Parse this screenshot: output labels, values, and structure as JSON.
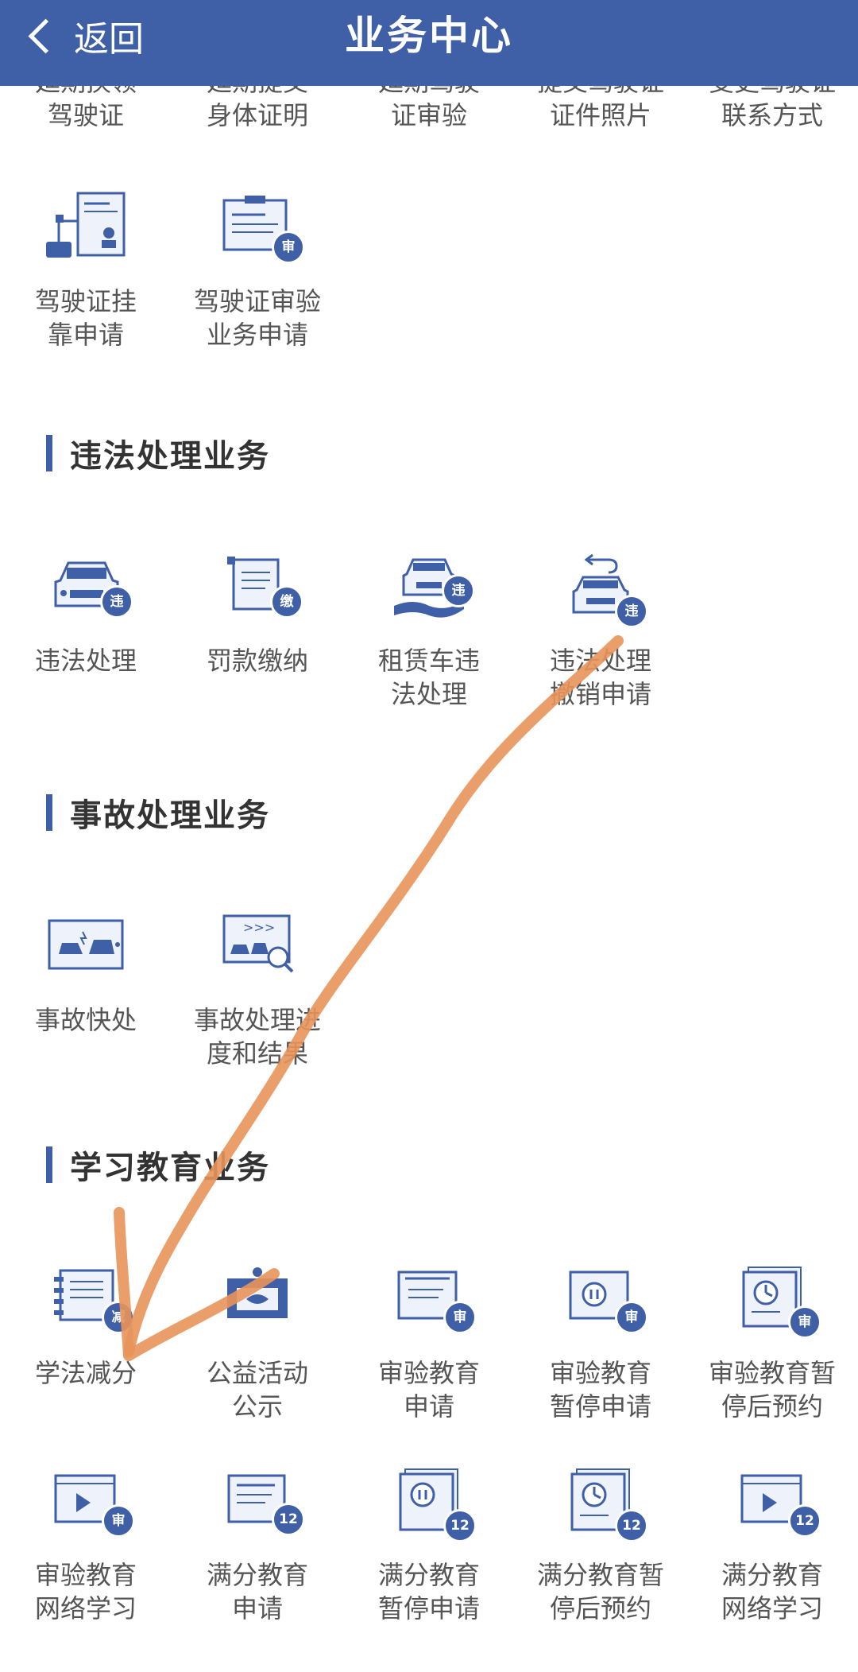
{
  "header": {
    "back_label": "返回",
    "title": "业务中心"
  },
  "top_row_partial": [
    "延期换领\n驾驶证",
    "延期提交\n身体证明",
    "延期驾驶\n证审验",
    "提交驾驶证\n证件照片",
    "变更驾驶证\n联系方式"
  ],
  "license_row2": [
    {
      "label": "驾驶证挂\n靠申请",
      "icon": "license-affiliation-icon"
    },
    {
      "label": "驾驶证审验\n业务申请",
      "icon": "license-review-icon",
      "badge": "审"
    }
  ],
  "sections": {
    "violation": {
      "title": "违法处理业务",
      "items": [
        {
          "label": "违法处理",
          "icon": "car-violation-icon",
          "badge": "违"
        },
        {
          "label": "罚款缴纳",
          "icon": "fine-payment-icon",
          "badge": "缴"
        },
        {
          "label": "租赁车违\n法处理",
          "icon": "rental-car-violation-icon",
          "badge": "违"
        },
        {
          "label": "违法处理\n撤销申请",
          "icon": "violation-revoke-icon",
          "badge": "违"
        }
      ]
    },
    "accident": {
      "title": "事故处理业务",
      "items": [
        {
          "label": "事故快处",
          "icon": "accident-quick-icon"
        },
        {
          "label": "事故处理进\n度和结果",
          "icon": "accident-progress-icon"
        }
      ]
    },
    "education": {
      "title": "学习教育业务",
      "row1": [
        {
          "label": "学法减分",
          "icon": "study-deduct-icon",
          "badge": "减"
        },
        {
          "label": "公益活动\n公示",
          "icon": "charity-activity-icon"
        },
        {
          "label": "审验教育\n申请",
          "icon": "review-edu-apply-icon",
          "badge": "审"
        },
        {
          "label": "审验教育\n暂停申请",
          "icon": "review-edu-pause-icon",
          "badge": "审"
        },
        {
          "label": "审验教育暂\n停后预约",
          "icon": "review-edu-appointment-icon",
          "badge": "审"
        }
      ],
      "row2": [
        {
          "label": "审验教育\n网络学习",
          "icon": "review-edu-online-icon",
          "badge": "审"
        },
        {
          "label": "满分教育\n申请",
          "icon": "full-score-apply-icon",
          "badge": "12"
        },
        {
          "label": "满分教育\n暂停申请",
          "icon": "full-score-pause-icon",
          "badge": "12"
        },
        {
          "label": "满分教育暂\n停后预约",
          "icon": "full-score-appointment-icon",
          "badge": "12"
        },
        {
          "label": "满分教育\n网络学习",
          "icon": "full-score-online-icon",
          "badge": "12"
        }
      ]
    }
  },
  "colors": {
    "header": "#3f5fa7",
    "icon": "#3f5fa7",
    "arrow": "#e8945a"
  }
}
